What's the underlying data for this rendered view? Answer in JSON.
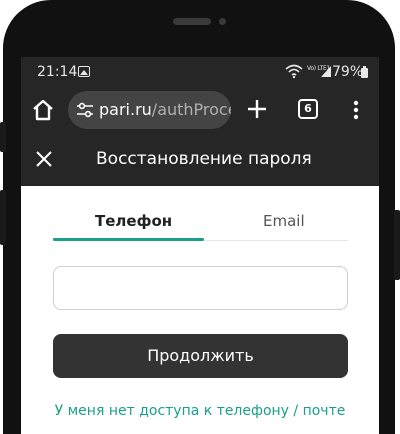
{
  "status_bar": {
    "time": "21:14",
    "network_label": "Vo) LTE1",
    "battery": "79%"
  },
  "browser": {
    "url_host": "pari.ru",
    "url_path": "/authProce",
    "tab_count": "6"
  },
  "page": {
    "title": "Восстановление пароля",
    "tabs": [
      {
        "label": "Телефон",
        "active": true
      },
      {
        "label": "Email",
        "active": false
      }
    ],
    "phone_input": {
      "value": "",
      "placeholder": ""
    },
    "continue_label": "Продолжить",
    "no_access_link": "У меня нет доступа к телефону / почте"
  },
  "colors": {
    "accent": "#1aa08a",
    "header_bg": "#262626",
    "button_bg": "#333333"
  },
  "icons": [
    "image-icon",
    "wifi-icon",
    "signal-icon",
    "battery-icon",
    "home-icon",
    "tune-icon",
    "plus-icon",
    "tabs-icon",
    "more-vert-icon",
    "close-icon"
  ]
}
